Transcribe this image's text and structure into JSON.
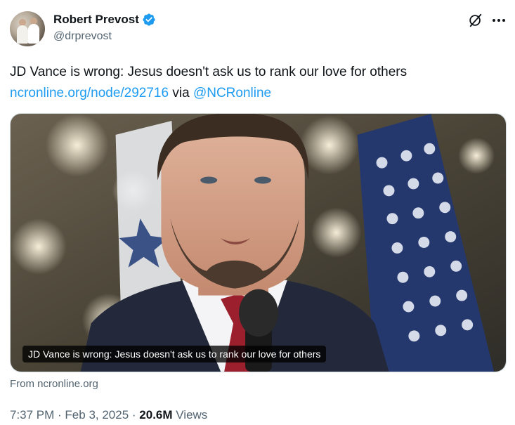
{
  "author": {
    "display_name": "Robert Prevost",
    "handle": "@drprevost",
    "verified": true,
    "verified_color": "#1d9bf0"
  },
  "tweet": {
    "text_line1": "JD Vance is wrong: Jesus doesn't ask us to rank our love for others",
    "link_text": "ncronline.org/node/292716",
    "via_text": " via ",
    "mention": "@NCRonline"
  },
  "card": {
    "title": "JD Vance is wrong: Jesus doesn't ask us to rank our love for others",
    "source": "From ncronline.org"
  },
  "meta": {
    "time": "7:37 PM",
    "sep1": " · ",
    "date": "Feb 3, 2025",
    "sep2": " · ",
    "views_count": "20.6M",
    "views_label": " Views"
  },
  "colors": {
    "link": "#1d9bf0",
    "secondary_text": "#536471",
    "primary_text": "#0f1419"
  },
  "icons": {
    "grok": "grok-icon",
    "more": "more-icon",
    "verified": "verified-badge-icon"
  }
}
